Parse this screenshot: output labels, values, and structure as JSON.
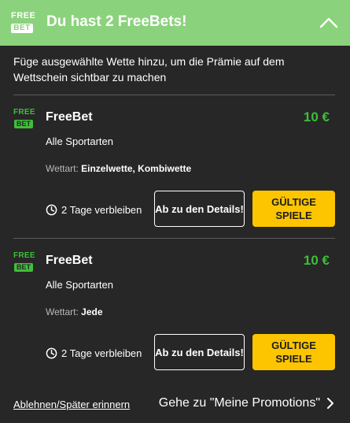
{
  "header": {
    "logo_top": "FREE",
    "logo_bottom": "BET",
    "title": "Du hast 2 FreeBets!",
    "collapse_icon": "chevron-up-icon"
  },
  "intro_text": "Füge ausgewählte Wette hinzu, um die Prämie auf dem Wettschein sichtbar zu machen",
  "offers": [
    {
      "logo_top": "FREE",
      "logo_bottom": "BET",
      "title": "FreeBet",
      "amount": "10 €",
      "sport": "Alle Sportarten",
      "bettype_label": "Wettart:",
      "bettype_value": "Einzelwette, Kombiwette",
      "time_left": "2 Tage verbleiben",
      "details_button": "Ab zu den Details!",
      "games_button": "GÜLTIGE SPIELE"
    },
    {
      "logo_top": "FREE",
      "logo_bottom": "BET",
      "title": "FreeBet",
      "amount": "10 €",
      "sport": "Alle Sportarten",
      "bettype_label": "Wettart:",
      "bettype_value": "Jede",
      "time_left": "2 Tage verbleiben",
      "details_button": "Ab zu den Details!",
      "games_button": "GÜLTIGE SPIELE"
    }
  ],
  "footer": {
    "decline_link": "Ablehnen/Später erinnern",
    "promotions_link": "Gehe zu \"Meine Promotions\""
  },
  "colors": {
    "header_bg": "#8bd27c",
    "panel_bg": "#272727",
    "amount_green": "#3fbe3a",
    "button_yellow": "#fcc500"
  }
}
